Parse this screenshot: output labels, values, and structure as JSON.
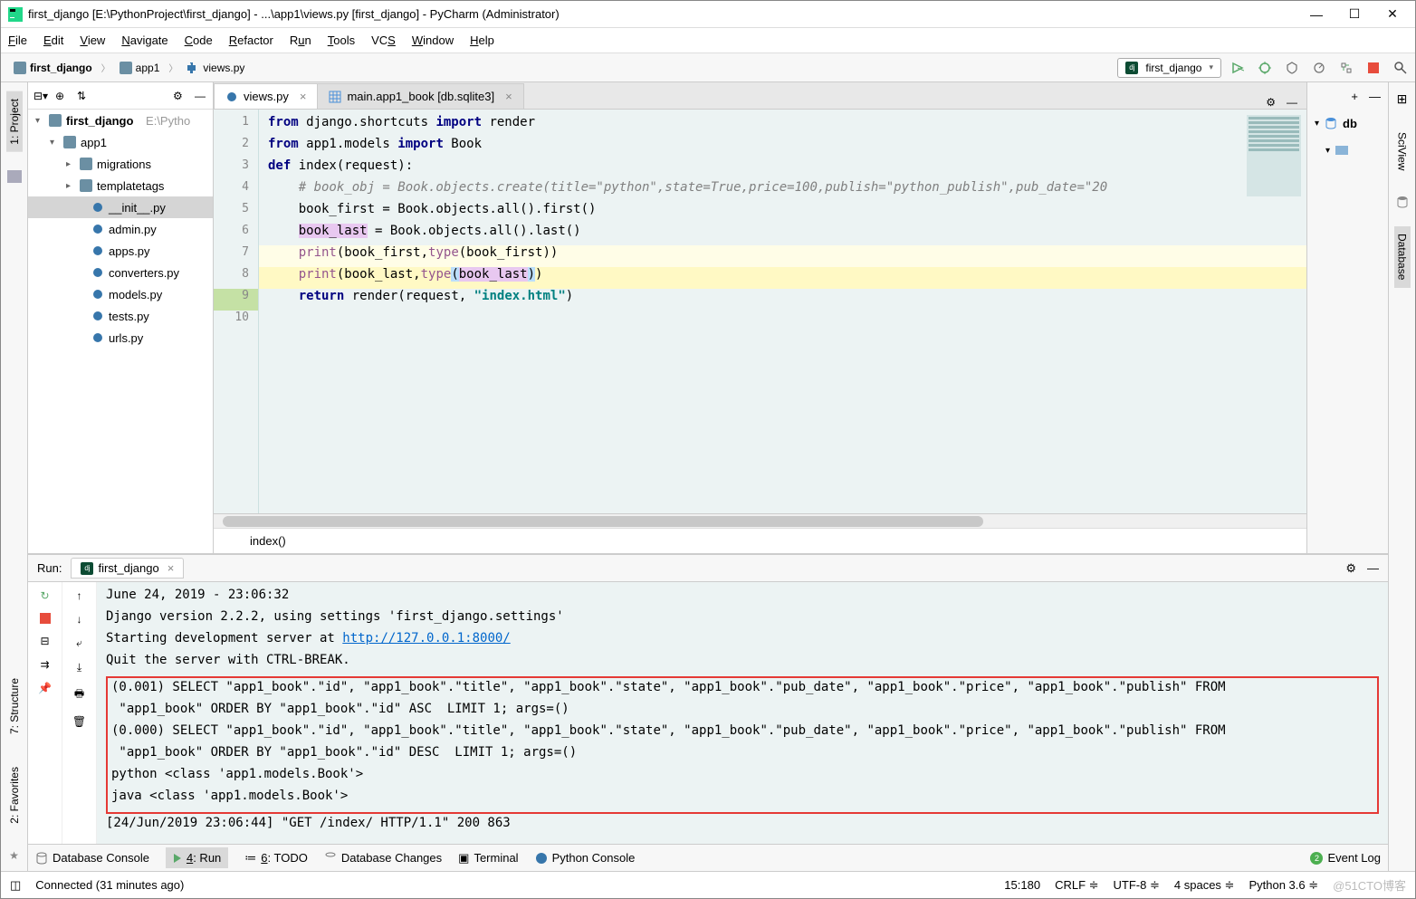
{
  "titlebar": {
    "title": "first_django [E:\\PythonProject\\first_django] - ...\\app1\\views.py [first_django] - PyCharm (Administrator)"
  },
  "menu": {
    "file": "File",
    "edit": "Edit",
    "view": "View",
    "navigate": "Navigate",
    "code": "Code",
    "refactor": "Refactor",
    "run": "Run",
    "tools": "Tools",
    "vcs": "VCS",
    "window": "Window",
    "help": "Help"
  },
  "breadcrumb": {
    "a": "first_django",
    "b": "app1",
    "c": "views.py"
  },
  "run_config": {
    "name": "first_django"
  },
  "project_panel": {
    "root": "first_django",
    "root_path": "E:\\Pytho",
    "app1": "app1",
    "migrations": "migrations",
    "templatetags": "templatetags",
    "files": [
      "__init__.py",
      "admin.py",
      "apps.py",
      "converters.py",
      "models.py",
      "tests.py",
      "urls.py"
    ]
  },
  "tabs": {
    "views": "views.py",
    "db": "main.app1_book [db.sqlite3]"
  },
  "gutter": [
    "1",
    "2",
    "3",
    "4",
    "5",
    "6",
    "7",
    "8",
    "9",
    "10"
  ],
  "code": {
    "l1": {
      "from": "from",
      "mod": " django.shortcuts ",
      "imp": "import",
      "rest": " render"
    },
    "l2": {
      "from": "from",
      "mod": " app1.models ",
      "imp": "import",
      "rest": " Book"
    },
    "l3": {
      "def": "def ",
      "fn": "index",
      "args": "(request):"
    },
    "l4": "    # book_obj = Book.objects.create(title=\"python\",state=True,price=100,publish=\"python_publish\",pub_date=\"20",
    "l5": {
      "a": "    book_first = Book.objects.",
      "b": "all",
      "c": "().",
      "d": "first",
      "e": "()"
    },
    "l6": {
      "a": "    ",
      "v": "book_last",
      "b": " = Book.objects.",
      "c": "all",
      "d": "().",
      "e": "last",
      "f": "()"
    },
    "l7": {
      "a": "    ",
      "p": "print",
      "b": "(book_first,",
      "t": "type",
      "c": "(book_first))"
    },
    "l8": {
      "a": "    ",
      "p": "print",
      "b": "(book_last,",
      "t": "type",
      "paren": "(",
      "arg": "book_last",
      ")": ")",
      ")2": ")"
    },
    "l9": {
      "a": "    ",
      "ret": "return ",
      "fn": "render",
      "b": "(request, ",
      "s": "\"index.html\"",
      "c": ")"
    }
  },
  "editor_breadcrumb": "index()",
  "side": {
    "db": "db"
  },
  "run": {
    "label": "Run:",
    "tab": "first_django",
    "lines": {
      "date": "June 24, 2019 - 23:06:32",
      "ver": "Django version 2.2.2, using settings 'first_django.settings'",
      "start": "Starting development server at ",
      "url": "http://127.0.0.1:8000/",
      "quit": "Quit the server with CTRL-BREAK.",
      "sql1": "(0.001) SELECT \"app1_book\".\"id\", \"app1_book\".\"title\", \"app1_book\".\"state\", \"app1_book\".\"pub_date\", \"app1_book\".\"price\", \"app1_book\".\"publish\" FROM",
      "sql1b": " \"app1_book\" ORDER BY \"app1_book\".\"id\" ASC  LIMIT 1; args=()",
      "sql2": "(0.000) SELECT \"app1_book\".\"id\", \"app1_book\".\"title\", \"app1_book\".\"state\", \"app1_book\".\"pub_date\", \"app1_book\".\"price\", \"app1_book\".\"publish\" FROM",
      "sql2b": " \"app1_book\" ORDER BY \"app1_book\".\"id\" DESC  LIMIT 1; args=()",
      "py": "python <class 'app1.models.Book'>",
      "jv": "java <class 'app1.models.Book'>",
      "req": "[24/Jun/2019 23:06:44] \"GET /index/ HTTP/1.1\" 200 863"
    }
  },
  "bottom_tools": {
    "dbc": "Database Console",
    "run": "4: Run",
    "todo": "6: TODO",
    "dbch": "Database Changes",
    "term": "Terminal",
    "pycon": "Python Console",
    "event": "Event Log"
  },
  "status": {
    "conn": "Connected (31 minutes ago)",
    "pos": "15:180",
    "crlf": "CRLF",
    "enc": "UTF-8",
    "indent": "4 spaces",
    "py": "Python 3.6",
    "wm": "@51CTO博客"
  },
  "left_tabs": {
    "project": "1: Project",
    "structure": "7: Structure",
    "fav": "2: Favorites"
  },
  "right_tabs": {
    "sci": "SciView",
    "db": "Database"
  }
}
